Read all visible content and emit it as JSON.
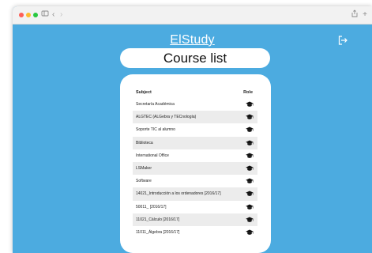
{
  "app": {
    "brand": "ElStudy"
  },
  "page": {
    "title": "Course list"
  },
  "table": {
    "headers": {
      "subject": "Subject",
      "role": "Role"
    },
    "role_icon": "graduation-cap-icon",
    "rows": [
      {
        "subject": "Secretaría Académica"
      },
      {
        "subject": "ALGTEC (ALGebra y TECnología)"
      },
      {
        "subject": "Soporte TIC al alumno"
      },
      {
        "subject": "Biblioteca"
      },
      {
        "subject": "International Office"
      },
      {
        "subject": "LSMaker"
      },
      {
        "subject": "Software"
      },
      {
        "subject": "14021_Introducción a los ordenadores [2016/17]"
      },
      {
        "subject": "50011_ [2016/17]"
      },
      {
        "subject": "11021_Cálculo [2016/17]"
      },
      {
        "subject": "11011_Álgebra [2016/17]"
      }
    ]
  },
  "colors": {
    "background": "#4cabe0",
    "card": "#ffffff",
    "row_shade": "#ececec"
  }
}
